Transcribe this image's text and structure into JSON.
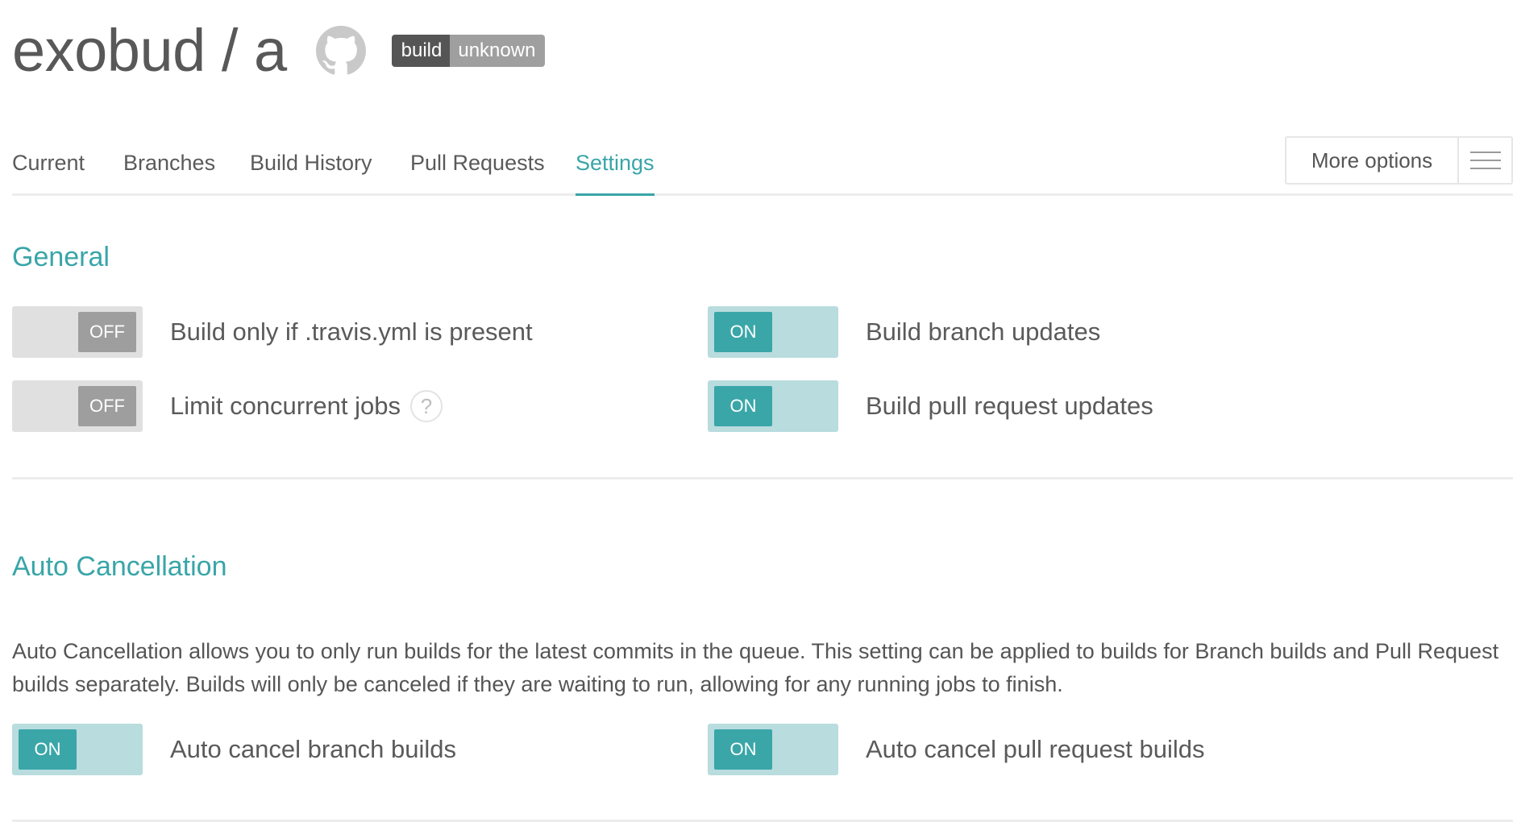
{
  "header": {
    "title": "exobud / a",
    "github_icon": "github-octocat-icon",
    "badge": {
      "left": "build",
      "right": "unknown"
    }
  },
  "tabs": [
    {
      "label": "Current",
      "active": false
    },
    {
      "label": "Branches",
      "active": false
    },
    {
      "label": "Build History",
      "active": false
    },
    {
      "label": "Pull Requests",
      "active": false
    },
    {
      "label": "Settings",
      "active": true
    }
  ],
  "more_options": {
    "label": "More options",
    "icon": "hamburger-menu-icon"
  },
  "general": {
    "title": "General",
    "settings": [
      {
        "label": "Build only if .travis.yml is present",
        "state": "OFF"
      },
      {
        "label": "Build branch updates",
        "state": "ON"
      },
      {
        "label": "Limit concurrent jobs",
        "state": "OFF",
        "help": "?"
      },
      {
        "label": "Build pull request updates",
        "state": "ON"
      }
    ]
  },
  "auto_cancellation": {
    "title": "Auto Cancellation",
    "description": "Auto Cancellation allows you to only run builds for the latest commits in the queue. This setting can be applied to builds for Branch builds and Pull Request builds separately. Builds will only be canceled if they are waiting to run, allowing for any running jobs to finish.",
    "settings": [
      {
        "label": "Auto cancel branch builds",
        "state": "ON"
      },
      {
        "label": "Auto cancel pull request builds",
        "state": "ON"
      }
    ]
  },
  "colors": {
    "accent": "#39a5a8",
    "toggle_on_track": "#b9dcde",
    "toggle_off_track": "#e0e0e0",
    "toggle_off_knob": "#9e9e9e"
  }
}
